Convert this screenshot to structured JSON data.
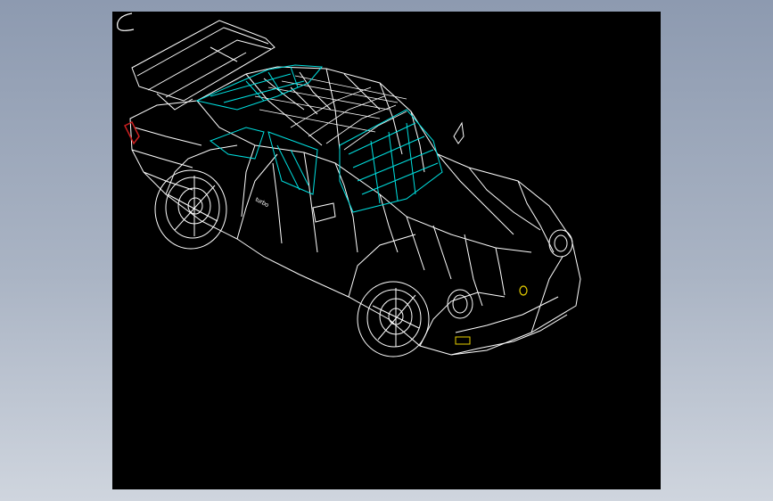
{
  "viewport": {
    "background": "#000000",
    "wire_color": "#ffffff",
    "glass_color": "#00e0e0",
    "tail_light_color": "#cc2020",
    "badge_color": "#e8d000"
  },
  "model": {
    "door_lettering": "turbo",
    "icon": "wireframe-car-model"
  },
  "ucs": {
    "icon": "ucs-corner-icon"
  }
}
